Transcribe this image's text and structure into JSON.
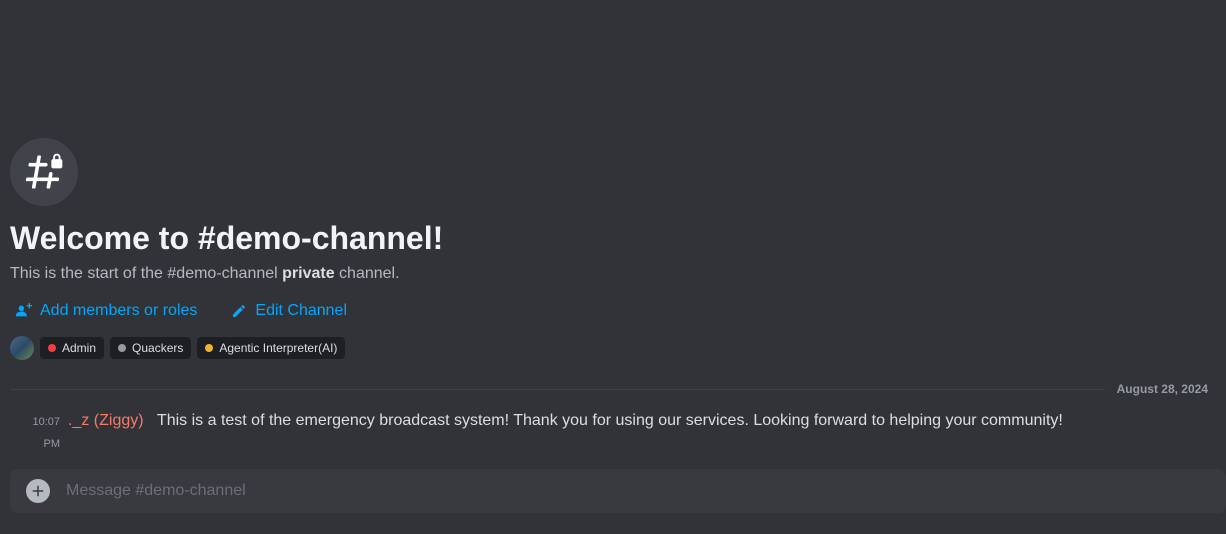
{
  "header": {
    "title": "Welcome to #demo-channel!",
    "subtitle_pre": "This is the start of the #demo-channel ",
    "subtitle_emph": "private",
    "subtitle_post": " channel."
  },
  "actions": {
    "add_members": "Add members or roles",
    "edit_channel": "Edit Channel"
  },
  "roles": [
    {
      "label": "Admin",
      "color": "#f23f43"
    },
    {
      "label": "Quackers",
      "color": "#949ba4"
    },
    {
      "label": "Agentic Interpreter(AI)",
      "color": "#f0b232"
    }
  ],
  "divider": {
    "date": "August 28, 2024"
  },
  "message": {
    "time": "10:07 PM",
    "author": "._z (Ziggy)",
    "text": "This is a test of the emergency broadcast system! Thank you for using our services. Looking forward to helping your community!"
  },
  "composer": {
    "placeholder": "Message #demo-channel"
  }
}
